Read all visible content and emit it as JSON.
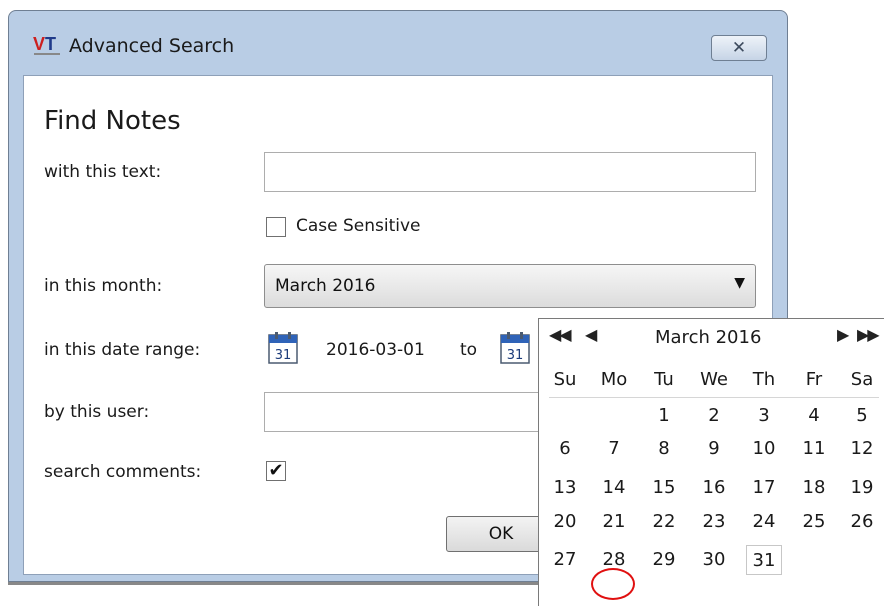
{
  "window": {
    "title": "Advanced Search",
    "close_icon": "close-x-icon",
    "logo_text": "VT"
  },
  "form": {
    "heading": "Find Notes",
    "labels": {
      "text": "with this text:",
      "month": "in this month:",
      "date_range": "in this date range:",
      "user": "by this user:",
      "comments": "search comments:"
    },
    "text_value": "",
    "case_sensitive_label": "Case Sensitive",
    "case_sensitive_checked": false,
    "month_value": "March 2016",
    "date_from": "2016-03-01",
    "date_to_label": "to",
    "user_value": "",
    "search_comments_checked": true,
    "ok_label": "OK",
    "calendar_icon_number": "31"
  },
  "calendar": {
    "month_label": "March 2016",
    "nav": {
      "prev_year": "◀◀",
      "prev_month": "◀",
      "next_month": "▶",
      "next_year": "▶▶"
    },
    "weekdays": [
      "Su",
      "Mo",
      "Tu",
      "We",
      "Th",
      "Fr",
      "Sa"
    ],
    "days": [
      [
        "",
        "",
        "1",
        "2",
        "3",
        "4",
        "5"
      ],
      [
        "6",
        "7",
        "8",
        "9",
        "10",
        "11",
        "12"
      ],
      [
        "13",
        "14",
        "15",
        "16",
        "17",
        "18",
        "19"
      ],
      [
        "20",
        "21",
        "22",
        "23",
        "24",
        "25",
        "26"
      ],
      [
        "27",
        "28",
        "29",
        "30",
        "31",
        "",
        ""
      ]
    ],
    "highlighted_day": "28",
    "today_day": "31",
    "highlight_color": "#e01010"
  }
}
